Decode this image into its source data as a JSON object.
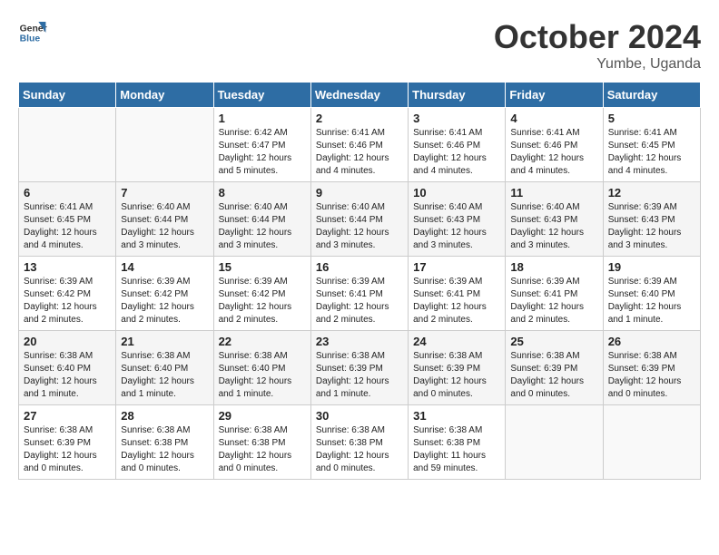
{
  "header": {
    "logo_line1": "General",
    "logo_line2": "Blue",
    "month": "October 2024",
    "location": "Yumbe, Uganda"
  },
  "weekdays": [
    "Sunday",
    "Monday",
    "Tuesday",
    "Wednesday",
    "Thursday",
    "Friday",
    "Saturday"
  ],
  "weeks": [
    [
      {
        "day": "",
        "info": ""
      },
      {
        "day": "",
        "info": ""
      },
      {
        "day": "1",
        "info": "Sunrise: 6:42 AM\nSunset: 6:47 PM\nDaylight: 12 hours\nand 5 minutes."
      },
      {
        "day": "2",
        "info": "Sunrise: 6:41 AM\nSunset: 6:46 PM\nDaylight: 12 hours\nand 4 minutes."
      },
      {
        "day": "3",
        "info": "Sunrise: 6:41 AM\nSunset: 6:46 PM\nDaylight: 12 hours\nand 4 minutes."
      },
      {
        "day": "4",
        "info": "Sunrise: 6:41 AM\nSunset: 6:46 PM\nDaylight: 12 hours\nand 4 minutes."
      },
      {
        "day": "5",
        "info": "Sunrise: 6:41 AM\nSunset: 6:45 PM\nDaylight: 12 hours\nand 4 minutes."
      }
    ],
    [
      {
        "day": "6",
        "info": "Sunrise: 6:41 AM\nSunset: 6:45 PM\nDaylight: 12 hours\nand 4 minutes."
      },
      {
        "day": "7",
        "info": "Sunrise: 6:40 AM\nSunset: 6:44 PM\nDaylight: 12 hours\nand 3 minutes."
      },
      {
        "day": "8",
        "info": "Sunrise: 6:40 AM\nSunset: 6:44 PM\nDaylight: 12 hours\nand 3 minutes."
      },
      {
        "day": "9",
        "info": "Sunrise: 6:40 AM\nSunset: 6:44 PM\nDaylight: 12 hours\nand 3 minutes."
      },
      {
        "day": "10",
        "info": "Sunrise: 6:40 AM\nSunset: 6:43 PM\nDaylight: 12 hours\nand 3 minutes."
      },
      {
        "day": "11",
        "info": "Sunrise: 6:40 AM\nSunset: 6:43 PM\nDaylight: 12 hours\nand 3 minutes."
      },
      {
        "day": "12",
        "info": "Sunrise: 6:39 AM\nSunset: 6:43 PM\nDaylight: 12 hours\nand 3 minutes."
      }
    ],
    [
      {
        "day": "13",
        "info": "Sunrise: 6:39 AM\nSunset: 6:42 PM\nDaylight: 12 hours\nand 2 minutes."
      },
      {
        "day": "14",
        "info": "Sunrise: 6:39 AM\nSunset: 6:42 PM\nDaylight: 12 hours\nand 2 minutes."
      },
      {
        "day": "15",
        "info": "Sunrise: 6:39 AM\nSunset: 6:42 PM\nDaylight: 12 hours\nand 2 minutes."
      },
      {
        "day": "16",
        "info": "Sunrise: 6:39 AM\nSunset: 6:41 PM\nDaylight: 12 hours\nand 2 minutes."
      },
      {
        "day": "17",
        "info": "Sunrise: 6:39 AM\nSunset: 6:41 PM\nDaylight: 12 hours\nand 2 minutes."
      },
      {
        "day": "18",
        "info": "Sunrise: 6:39 AM\nSunset: 6:41 PM\nDaylight: 12 hours\nand 2 minutes."
      },
      {
        "day": "19",
        "info": "Sunrise: 6:39 AM\nSunset: 6:40 PM\nDaylight: 12 hours\nand 1 minute."
      }
    ],
    [
      {
        "day": "20",
        "info": "Sunrise: 6:38 AM\nSunset: 6:40 PM\nDaylight: 12 hours\nand 1 minute."
      },
      {
        "day": "21",
        "info": "Sunrise: 6:38 AM\nSunset: 6:40 PM\nDaylight: 12 hours\nand 1 minute."
      },
      {
        "day": "22",
        "info": "Sunrise: 6:38 AM\nSunset: 6:40 PM\nDaylight: 12 hours\nand 1 minute."
      },
      {
        "day": "23",
        "info": "Sunrise: 6:38 AM\nSunset: 6:39 PM\nDaylight: 12 hours\nand 1 minute."
      },
      {
        "day": "24",
        "info": "Sunrise: 6:38 AM\nSunset: 6:39 PM\nDaylight: 12 hours\nand 0 minutes."
      },
      {
        "day": "25",
        "info": "Sunrise: 6:38 AM\nSunset: 6:39 PM\nDaylight: 12 hours\nand 0 minutes."
      },
      {
        "day": "26",
        "info": "Sunrise: 6:38 AM\nSunset: 6:39 PM\nDaylight: 12 hours\nand 0 minutes."
      }
    ],
    [
      {
        "day": "27",
        "info": "Sunrise: 6:38 AM\nSunset: 6:39 PM\nDaylight: 12 hours\nand 0 minutes."
      },
      {
        "day": "28",
        "info": "Sunrise: 6:38 AM\nSunset: 6:38 PM\nDaylight: 12 hours\nand 0 minutes."
      },
      {
        "day": "29",
        "info": "Sunrise: 6:38 AM\nSunset: 6:38 PM\nDaylight: 12 hours\nand 0 minutes."
      },
      {
        "day": "30",
        "info": "Sunrise: 6:38 AM\nSunset: 6:38 PM\nDaylight: 12 hours\nand 0 minutes."
      },
      {
        "day": "31",
        "info": "Sunrise: 6:38 AM\nSunset: 6:38 PM\nDaylight: 11 hours\nand 59 minutes."
      },
      {
        "day": "",
        "info": ""
      },
      {
        "day": "",
        "info": ""
      }
    ]
  ]
}
